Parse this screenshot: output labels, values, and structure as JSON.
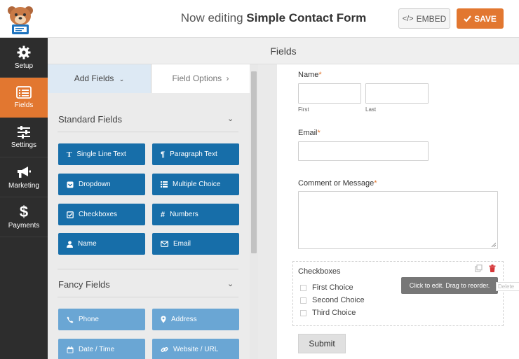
{
  "header": {
    "title_prefix": "Now editing",
    "form_name": "Simple Contact Form",
    "embed_label": "EMBED",
    "save_label": "SAVE",
    "accent_color": "#e27730"
  },
  "sidebar": {
    "items": [
      {
        "label": "Setup",
        "icon": "gear-icon"
      },
      {
        "label": "Fields",
        "icon": "list-icon",
        "active": true
      },
      {
        "label": "Settings",
        "icon": "sliders-icon"
      },
      {
        "label": "Marketing",
        "icon": "megaphone-icon"
      },
      {
        "label": "Payments",
        "icon": "dollar-icon"
      }
    ]
  },
  "panel": {
    "header": "Fields",
    "tabs": {
      "add": "Add Fields",
      "options": "Field Options"
    },
    "standard_title": "Standard Fields",
    "standard_fields": [
      {
        "label": "Single Line Text",
        "icon": "text-icon"
      },
      {
        "label": "Paragraph Text",
        "icon": "paragraph-icon"
      },
      {
        "label": "Dropdown",
        "icon": "dropdown-icon"
      },
      {
        "label": "Multiple Choice",
        "icon": "list-icon"
      },
      {
        "label": "Checkboxes",
        "icon": "checkbox-icon"
      },
      {
        "label": "Numbers",
        "icon": "hash-icon"
      },
      {
        "label": "Name",
        "icon": "user-icon"
      },
      {
        "label": "Email",
        "icon": "envelope-icon"
      }
    ],
    "fancy_title": "Fancy Fields",
    "fancy_fields": [
      {
        "label": "Phone",
        "icon": "phone-icon"
      },
      {
        "label": "Address",
        "icon": "map-pin-icon"
      },
      {
        "label": "Date / Time",
        "icon": "calendar-icon"
      },
      {
        "label": "Website / URL",
        "icon": "link-icon"
      }
    ]
  },
  "form": {
    "name_label": "Name",
    "first_sublabel": "First",
    "last_sublabel": "Last",
    "email_label": "Email",
    "comment_label": "Comment or Message",
    "required_mark": "*",
    "checkboxes_label": "Checkboxes",
    "choices": [
      "First Choice",
      "Second Choice",
      "Third Choice"
    ],
    "tooltip": "Click to edit. Drag to reorder.",
    "delete_tip": "Delete",
    "submit_label": "Submit"
  }
}
